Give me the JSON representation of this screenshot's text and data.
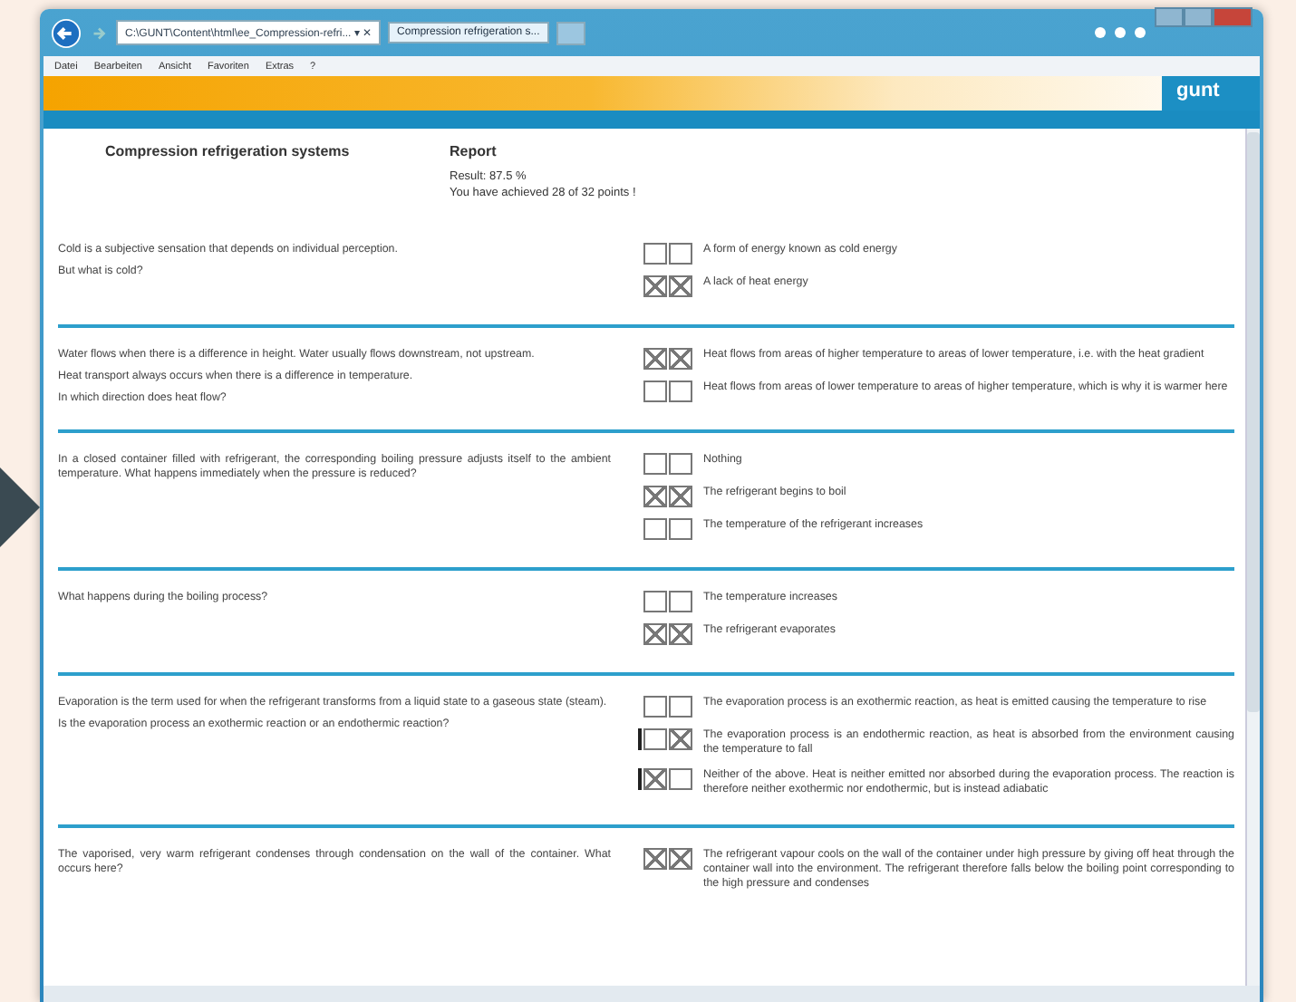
{
  "browser": {
    "address": "C:\\GUNT\\Content\\html\\ee_Compression-refri... ▾ ✕",
    "tab_title": "Compression refrigeration s...",
    "menu": [
      "Datei",
      "Bearbeiten",
      "Ansicht",
      "Favoriten",
      "Extras",
      "?"
    ]
  },
  "header": {
    "logo": "gunt"
  },
  "report": {
    "subject": "Compression refrigeration systems",
    "title": "Report",
    "result": "Result: 87.5 %",
    "points": "You have achieved 28 of 32 points !"
  },
  "questions": [
    {
      "text": [
        "Cold is a subjective sensation that depends on individual perception.",
        "But what is cold?"
      ],
      "answers": [
        {
          "text": "A form of energy known as cold energy",
          "given": false,
          "correct": false,
          "flagged": false
        },
        {
          "text": "A lack of heat energy",
          "given": true,
          "correct": true,
          "flagged": false
        }
      ]
    },
    {
      "text": [
        "Water flows when there is a difference in height. Water usually flows downstream, not upstream.",
        "Heat transport always occurs when there is a difference in temperature.",
        "In which direction does heat flow?"
      ],
      "answers": [
        {
          "text": "Heat flows from areas of higher temperature to areas of lower temperature, i.e. with the heat gradient",
          "given": true,
          "correct": true,
          "flagged": false
        },
        {
          "text": "Heat flows from areas of lower temperature to areas of higher temperature, which is why it is warmer here",
          "given": false,
          "correct": false,
          "flagged": false
        }
      ]
    },
    {
      "text": [
        "In a closed container filled with refrigerant, the corresponding boiling pressure adjusts itself to the ambient temperature. What happens immediately when the pressure is reduced?"
      ],
      "answers": [
        {
          "text": "Nothing",
          "given": false,
          "correct": false,
          "flagged": false
        },
        {
          "text": "The refrigerant begins to boil",
          "given": true,
          "correct": true,
          "flagged": false
        },
        {
          "text": "The temperature of the refrigerant increases",
          "given": false,
          "correct": false,
          "flagged": false
        }
      ]
    },
    {
      "text": [
        "What happens during the boiling process?"
      ],
      "answers": [
        {
          "text": "The temperature increases",
          "given": false,
          "correct": false,
          "flagged": false
        },
        {
          "text": "The refrigerant evaporates",
          "given": true,
          "correct": true,
          "flagged": false
        }
      ]
    },
    {
      "text": [
        "Evaporation is the term used for when the refrigerant transforms from a liquid state to a gaseous state (steam).",
        "Is the evaporation process an exothermic reaction or an endothermic reaction?"
      ],
      "answers": [
        {
          "text": "The evaporation process is an exothermic reaction, as heat is emitted causing the temperature to rise",
          "given": false,
          "correct": false,
          "flagged": false
        },
        {
          "text": "The evaporation process is an endothermic reaction, as heat is absorbed from the environment causing the temperature to fall",
          "given": false,
          "correct": true,
          "flagged": true
        },
        {
          "text": "Neither of the above. Heat is neither emitted nor absorbed during the evaporation process. The reaction is therefore neither exothermic nor endothermic, but is instead adiabatic",
          "given": true,
          "correct": false,
          "flagged": true
        }
      ]
    },
    {
      "text": [
        "The vaporised, very warm refrigerant condenses through condensation on the wall of the container. What occurs here?"
      ],
      "answers": [
        {
          "text": "The refrigerant vapour cools on the wall of the container under high pressure by giving off heat through the container wall into the environment. The refrigerant therefore falls below the boiling point corresponding to the high pressure and condenses",
          "given": true,
          "correct": true,
          "flagged": false
        }
      ]
    }
  ]
}
